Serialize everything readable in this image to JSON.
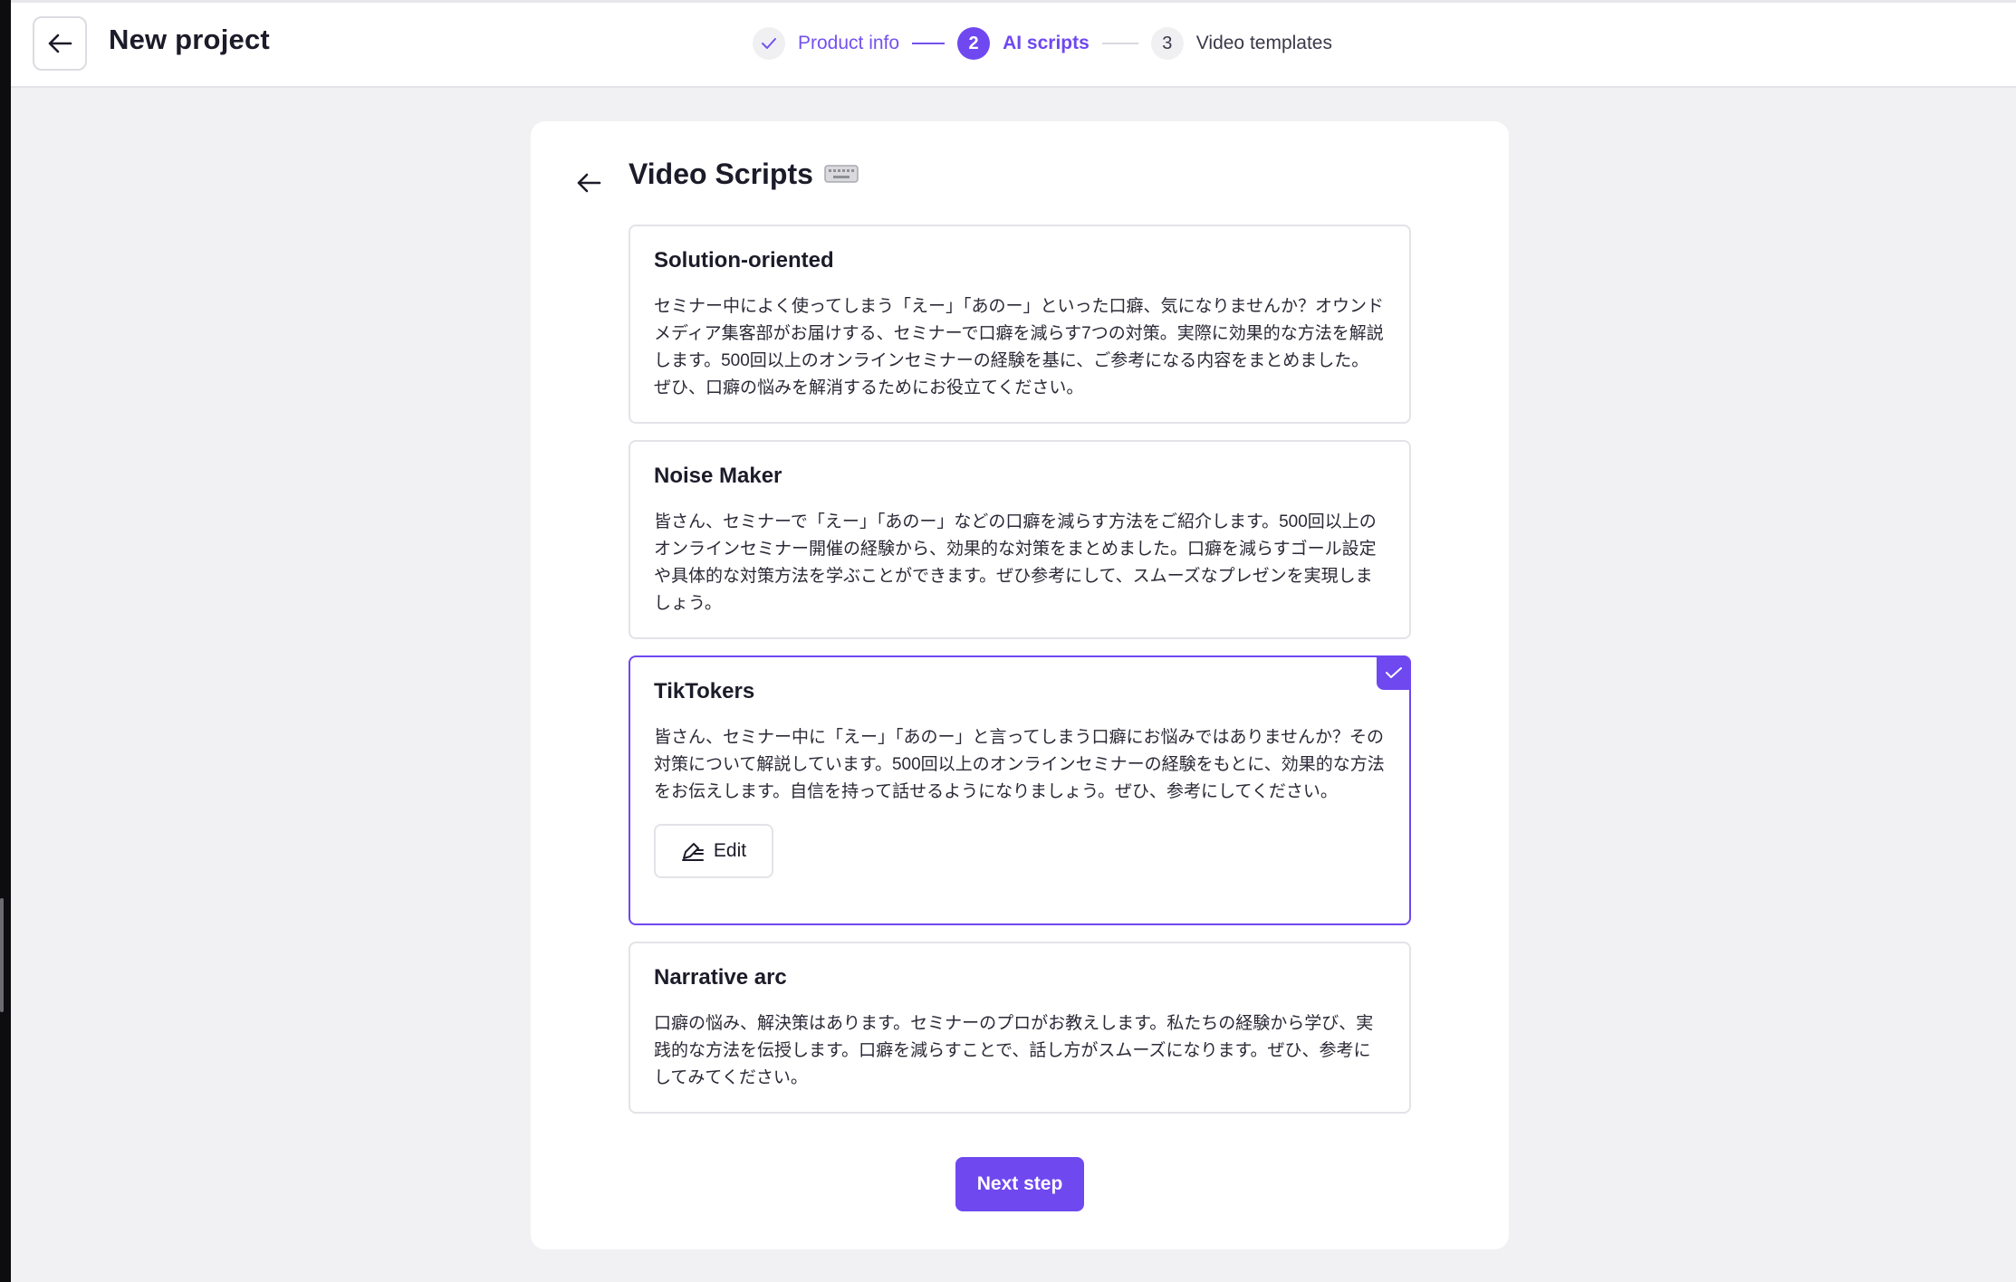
{
  "header": {
    "title": "New project"
  },
  "stepper": {
    "steps": [
      {
        "number": "",
        "label": "Product info",
        "state": "done"
      },
      {
        "number": "2",
        "label": "AI scripts",
        "state": "active"
      },
      {
        "number": "3",
        "label": "Video templates",
        "state": "todo"
      }
    ]
  },
  "panel": {
    "title": "Video Scripts",
    "cards": [
      {
        "title": "Solution-oriented",
        "text": "セミナー中によく使ってしまう「えー」「あのー」といった口癖、気になりませんか？オウンドメディア集客部がお届けする、セミナーで口癖を減らす7つの対策。実際に効果的な方法を解説します。500回以上のオンラインセミナーの経験を基に、ご参考になる内容をまとめました。ぜひ、口癖の悩みを解消するためにお役立てください。",
        "selected": false
      },
      {
        "title": "Noise Maker",
        "text": "皆さん、セミナーで「えー」「あのー」などの口癖を減らす方法をご紹介します。500回以上のオンラインセミナー開催の経験から、効果的な対策をまとめました。口癖を減らすゴール設定や具体的な対策方法を学ぶことができます。ぜひ参考にして、スムーズなプレゼンを実現しましょう。",
        "selected": false
      },
      {
        "title": "TikTokers",
        "text": "皆さん、セミナー中に「えー」「あのー」と言ってしまう口癖にお悩みではありませんか？その対策について解説しています。500回以上のオンラインセミナーの経験をもとに、効果的な方法をお伝えします。自信を持って話せるようになりましょう。ぜひ、参考にしてください。",
        "selected": true,
        "edit_label": "Edit"
      },
      {
        "title": "Narrative arc",
        "text": "口癖の悩み、解決策はあります。セミナーのプロがお教えします。私たちの経験から学び、実践的な方法を伝授します。口癖を減らすことで、話し方がスムーズになります。ぜひ、参考にしてみてください。",
        "selected": false
      }
    ],
    "next_label": "Next step"
  },
  "colors": {
    "accent": "#6f48f0",
    "background": "#f1f1f3",
    "border": "#e3e3e8"
  }
}
